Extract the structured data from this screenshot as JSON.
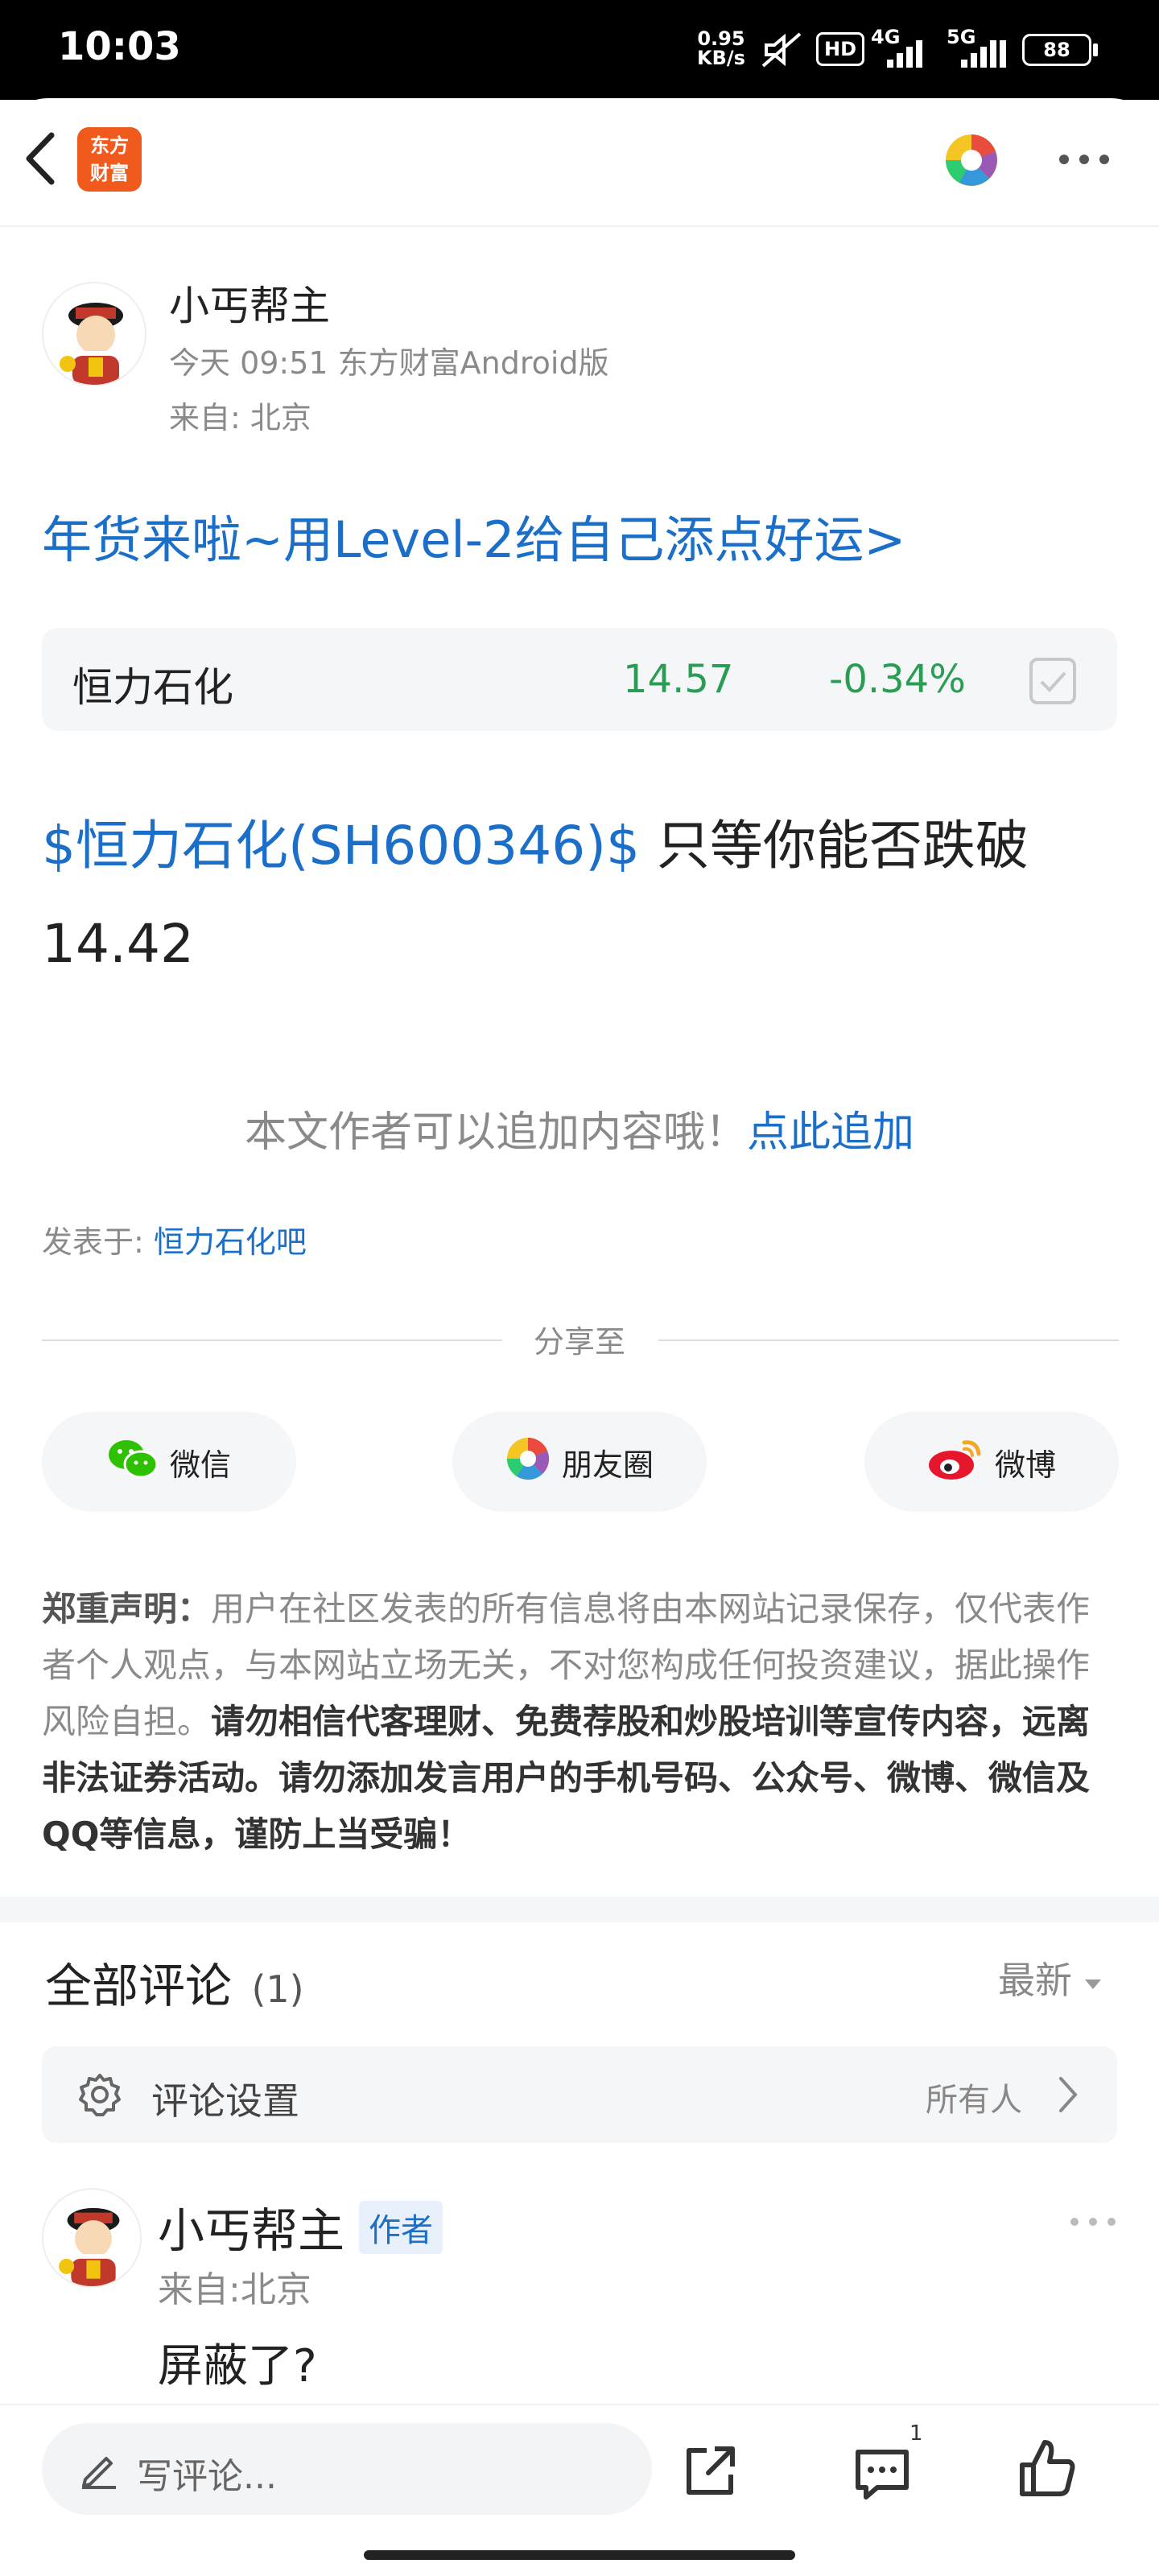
{
  "status_bar": {
    "time": "10:03",
    "net_speed_value": "0.95",
    "net_speed_unit": "KB/s",
    "hd_label": "HD",
    "net1": "4G",
    "net2": "5G",
    "battery": "88"
  },
  "header": {
    "logo_line1": "东方",
    "logo_line2": "财富"
  },
  "post": {
    "author": "小丐帮主",
    "meta_line": "今天 09:51 东方财富Android版",
    "location": "来自: 北京",
    "promo_link": "年货来啦~用Level-2给自己添点好运>",
    "stock_card": {
      "name": "恒力石化",
      "price": "14.57",
      "change": "-0.34%"
    },
    "body_link": "$恒力石化(SH600346)$",
    "body_text_rest": " 只等你能否跌破",
    "body_text_line2": "14.42",
    "append_hint": "本文作者可以追加内容哦！",
    "append_link": "点此追加",
    "posted_in_label": "发表于: ",
    "posted_in_link": "恒力石化吧"
  },
  "share": {
    "title": "分享至",
    "wechat": "微信",
    "moments": "朋友圈",
    "weibo": "微博"
  },
  "disclaimer": {
    "label": "郑重声明：",
    "grey_text": "用户在社区发表的所有信息将由本网站记录保存，仅代表作者个人观点，与本网站立场无关，不对您构成任何投资建议，据此操作风险自担。",
    "dark_text": "请勿相信代客理财、免费荐股和炒股培训等宣传内容，远离非法证券活动。请勿添加发言用户的手机号码、公众号、微博、微信及QQ等信息，谨防上当受骗！"
  },
  "comments": {
    "title": "全部评论",
    "count": "(1)",
    "sort": "最新",
    "settings_label": "评论设置",
    "settings_value": "所有人",
    "items": [
      {
        "author": "小丐帮主",
        "badge": "作者",
        "location": "来自:北京",
        "text": "屏蔽了?"
      }
    ]
  },
  "bottom_bar": {
    "input_placeholder": "写评论...",
    "comment_count": "1"
  },
  "colors": {
    "link_blue": "#1b6fc8",
    "price_green": "#2a9d55",
    "brand_orange": "#f05a1c"
  },
  "icons": [
    "back-arrow-icon",
    "eastmoney-logo-icon",
    "color-wheel-icon",
    "more-dots-icon",
    "checkbox-icon",
    "wechat-icon",
    "moments-icon",
    "weibo-icon",
    "gear-icon",
    "chevron-right-icon",
    "pencil-icon",
    "share-icon",
    "comment-icon",
    "thumbs-up-icon"
  ]
}
